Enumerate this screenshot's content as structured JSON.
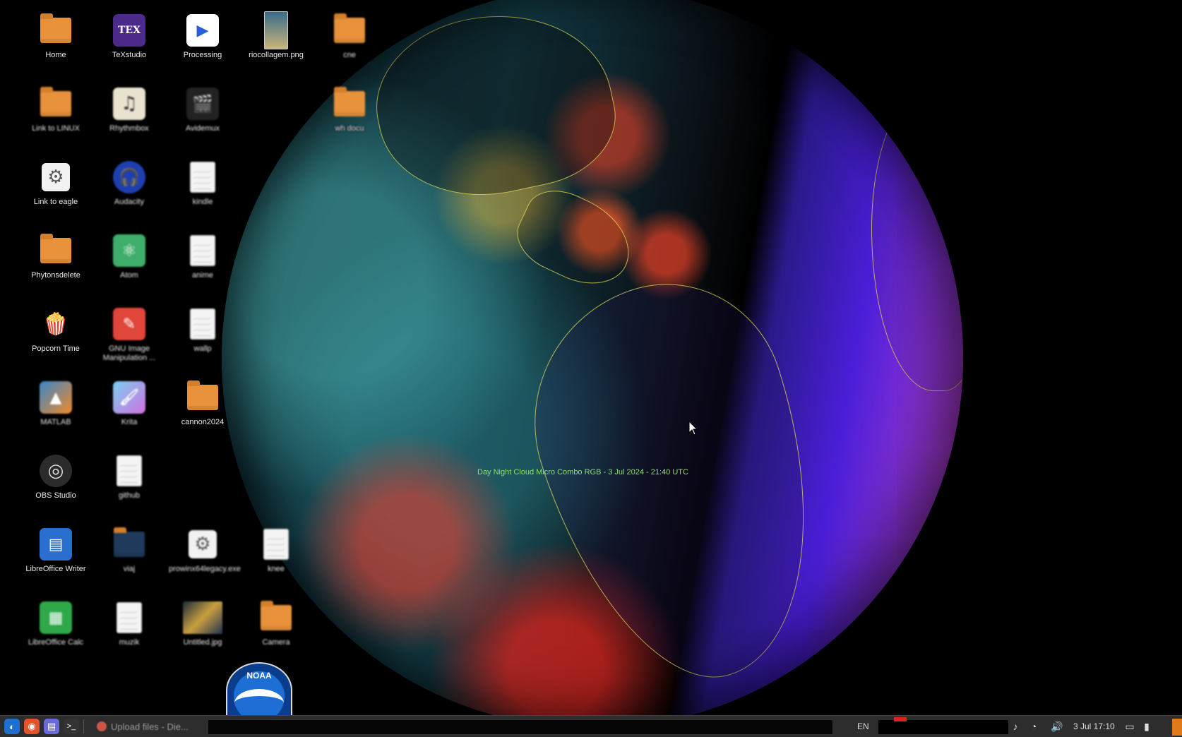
{
  "wallpaper": {
    "caption": "Day Night Cloud Micro Combo RGB - 3 Jul 2024 - 21:40 UTC"
  },
  "desktop_icons": [
    {
      "label": "Home",
      "icon": "home-folder-icon"
    },
    {
      "label": "TeXstudio",
      "icon": "texstudio-icon",
      "badge": "TEX"
    },
    {
      "label": "Processing",
      "icon": "processing-icon"
    },
    {
      "label": "riocollagem.png",
      "icon": "image-file-icon"
    },
    {
      "label": "cne",
      "icon": "folder-icon"
    },
    {
      "label": "Link to LINUX",
      "icon": "folder-link-icon"
    },
    {
      "label": "Rhythmbox",
      "icon": "rhythmbox-icon"
    },
    {
      "label": "Avidemux",
      "icon": "avidemux-icon"
    },
    {
      "label": "wh docu",
      "icon": "folder-icon"
    },
    {
      "label": "Link to eagle",
      "icon": "gear-link-icon"
    },
    {
      "label": "Audacity",
      "icon": "audacity-icon"
    },
    {
      "label": "kindle",
      "icon": "text-file-icon"
    },
    {
      "label": "Phytonsdelete",
      "icon": "folder-icon"
    },
    {
      "label": "Atom",
      "icon": "atom-icon"
    },
    {
      "label": "anime",
      "icon": "text-file-icon"
    },
    {
      "label": "Popcorn Time",
      "icon": "popcorn-icon"
    },
    {
      "label": "GNU Image Manipulation ...",
      "icon": "gimp-icon"
    },
    {
      "label": "wallp",
      "icon": "text-file-icon"
    },
    {
      "label": "MATLAB",
      "icon": "matlab-icon"
    },
    {
      "label": "Krita",
      "icon": "krita-icon"
    },
    {
      "label": "cannon2024",
      "icon": "folder-icon"
    },
    {
      "label": "OBS Studio",
      "icon": "obs-icon"
    },
    {
      "label": "github",
      "icon": "text-file-icon"
    },
    {
      "label": "LibreOffice Writer",
      "icon": "writer-icon"
    },
    {
      "label": "viaj",
      "icon": "dark-folder-icon"
    },
    {
      "label": "prowinx64legacy.exe",
      "icon": "exe-gear-icon"
    },
    {
      "label": "knee",
      "icon": "text-file-icon"
    },
    {
      "label": "LibreOffice Calc",
      "icon": "calc-icon"
    },
    {
      "label": "muzik",
      "icon": "text-file-icon"
    },
    {
      "label": "Untitled.jpg",
      "icon": "image-file-icon"
    },
    {
      "label": "Camera",
      "icon": "folder-icon"
    }
  ],
  "noaa_logo_text": "NOAA",
  "taskbar": {
    "launchers": [
      "menu-icon",
      "firefox-icon",
      "files-icon",
      "terminal-icon"
    ],
    "task_label": "Upload files - Die...",
    "language": "EN",
    "clock": "3 Jul 17:10",
    "tray_icons": [
      "music-icon",
      "wifi-icon",
      "volume-icon",
      "display-icon",
      "battery-icon"
    ]
  }
}
